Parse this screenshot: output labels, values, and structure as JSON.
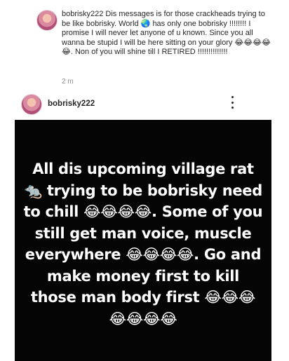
{
  "comment": {
    "username": "bobrisky222",
    "text": "Dis messages is for those crackheads trying to be like bobrisky. World 🌏 has only one bobrisky !!!!!!!! I promise I will never let anyone of u known. Since you all wanna be stupid I will be here sitting on your glory 😂😂😂😂😂. Non of you will shine till I RETIRED !!!!!!!!!!!!!!",
    "time": "2 m"
  },
  "post": {
    "username": "bobrisky222",
    "story_text": "All dis upcoming village rat 🐀 trying to be bobrisky need to chill 😂😂😂😂. Some of you still get man voice, muscle everywhere 😂😂😂😂. Go and make money first to kill those man body first 😂😂😂😂😂😂😂"
  }
}
